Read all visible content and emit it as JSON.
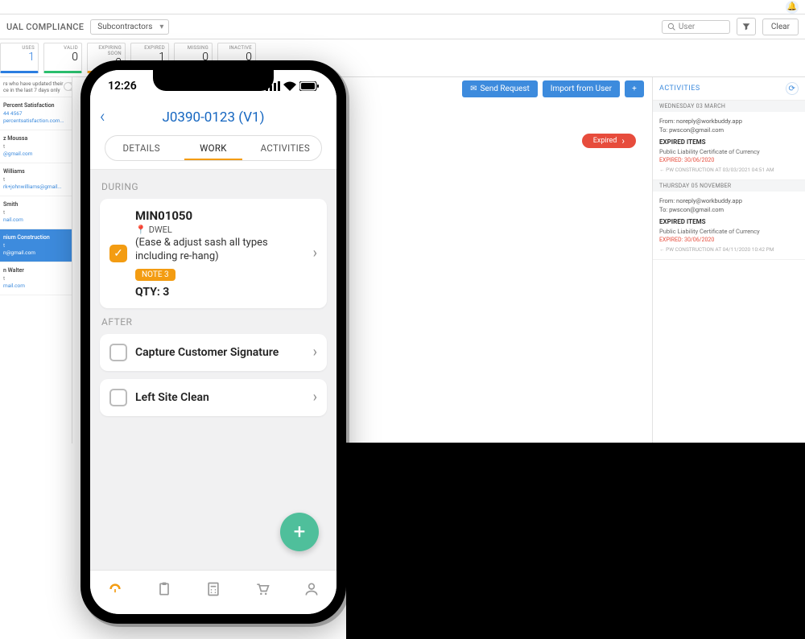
{
  "desktop": {
    "page_title": "UAL COMPLIANCE",
    "dropdown": "Subcontractors",
    "search_placeholder": "User",
    "clear_label": "Clear",
    "stats": [
      {
        "label": "USES",
        "value": "1",
        "cls": "blue"
      },
      {
        "label": "VALID",
        "value": "0",
        "cls": "green"
      },
      {
        "label": "EXPIRING SOON",
        "value": "0",
        "cls": "orange"
      },
      {
        "label": "EXPIRED",
        "value": "1",
        "cls": "red"
      },
      {
        "label": "MISSING",
        "value": "0",
        "cls": "purple"
      },
      {
        "label": "INACTIVE",
        "value": "0",
        "cls": "grey"
      }
    ],
    "sidebar_note": "rs who have updated their ce in the last 7 days only",
    "contacts": [
      {
        "name": "Percent Satisfaction",
        "sub": "",
        "phone": "44 4567",
        "email": "percentsatisfaction.com..."
      },
      {
        "name": "z Moussa",
        "sub": "t",
        "phone": "",
        "email": "@gmail.com"
      },
      {
        "name": "Williams",
        "sub": "t",
        "phone": "",
        "email": "rk+johnwilliams@gmail..."
      },
      {
        "name": "Smith",
        "sub": "t",
        "phone": "",
        "email": "nail.com"
      },
      {
        "name": "nium Construction",
        "sub": "t",
        "phone": "",
        "email": "n@gmail.com",
        "active": true
      },
      {
        "name": "n Walter",
        "sub": "t",
        "phone": "",
        "email": "mail.com"
      }
    ],
    "actions": {
      "send_request": "Send Request",
      "import_user": "Import from User",
      "plus": "+"
    },
    "expired_badge": "Expired",
    "activities": {
      "title": "ACTIVITIES",
      "groups": [
        {
          "date": "WEDNESDAY 03 MARCH",
          "from": "From: noreply@workbuddy.app",
          "to": "To: pwscon@gmail.com",
          "header": "EXPIRED ITEMS",
          "item": "Public Liability Certificate of Currency",
          "exp": "EXPIRED: 30/06/2020",
          "meta": "PW CONSTRUCTION AT 03/03/2021 04:51 AM"
        },
        {
          "date": "THURSDAY 05 NOVEMBER",
          "from": "From: noreply@workbuddy.app",
          "to": "To: pwscon@gmail.com",
          "header": "EXPIRED ITEMS",
          "item": "Public Liability Certificate of Currency",
          "exp": "EXPIRED: 30/06/2020",
          "meta": "PW CONSTRUCTION AT 04/11/2020 10:42 PM"
        }
      ]
    }
  },
  "phone": {
    "time": "12:26",
    "title": "J0390-0123 (V1)",
    "tabs": {
      "details": "DETAILS",
      "work": "WORK",
      "activities": "ACTIVITIES"
    },
    "sections": {
      "during_label": "DURING",
      "during": {
        "code": "MIN01050",
        "loc": "DWEL",
        "desc": "(Ease & adjust sash all types including re-hang)",
        "note": "NOTE 3",
        "qty": "QTY: 3"
      },
      "after_label": "AFTER",
      "after": [
        "Capture Customer Signature",
        "Left Site Clean"
      ]
    },
    "fab": "+"
  }
}
